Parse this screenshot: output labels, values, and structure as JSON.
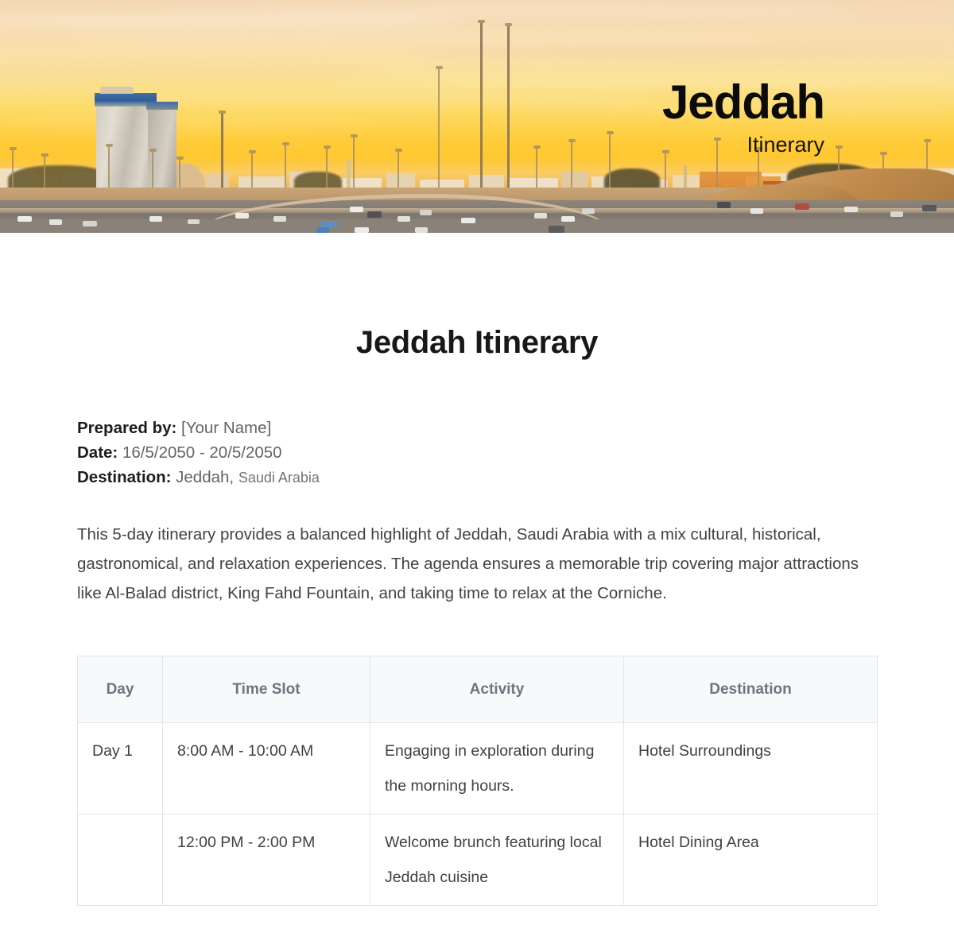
{
  "banner": {
    "title": "Jeddah",
    "subtitle": "Itinerary",
    "image_alt": "jeddah-sunset-skyline-highway"
  },
  "document": {
    "title": "Jeddah Itinerary",
    "meta": {
      "prepared_by_label": "Prepared by:",
      "prepared_by_value": "[Your Name]",
      "date_label": "Date:",
      "date_value": "16/5/2050 - 20/5/2050",
      "destination_label": "Destination:",
      "destination_city": "Jeddah,",
      "destination_country": "Saudi Arabia"
    },
    "intro": "This 5-day itinerary provides a balanced highlight of Jeddah, Saudi Arabia with a mix cultural, historical, gastronomical, and relaxation experiences. The agenda ensures a memorable trip covering major attractions like Al-Balad district, King Fahd Fountain, and taking time to relax at the Corniche."
  },
  "table": {
    "headers": {
      "day": "Day",
      "time_slot": "Time Slot",
      "activity": "Activity",
      "destination": "Destination"
    },
    "rows": [
      {
        "day": "Day 1",
        "time_slot": "8:00 AM - 10:00 AM",
        "activity": "Engaging in exploration during the morning hours.",
        "destination": "Hotel Surroundings"
      },
      {
        "day": "",
        "time_slot": "12:00 PM - 2:00 PM",
        "activity": "Welcome brunch featuring local Jeddah cuisine",
        "destination": "Hotel Dining Area"
      }
    ]
  },
  "colors": {
    "sky_top": "#f3d7b4",
    "sky_bottom": "#f7b825",
    "title_text": "#0b0b0b",
    "heading_text": "#16181a",
    "body_text": "#3f4447",
    "table_header_bg": "#f7f9fb",
    "table_header_text": "#6d767e",
    "table_border": "#e2e4e7"
  }
}
